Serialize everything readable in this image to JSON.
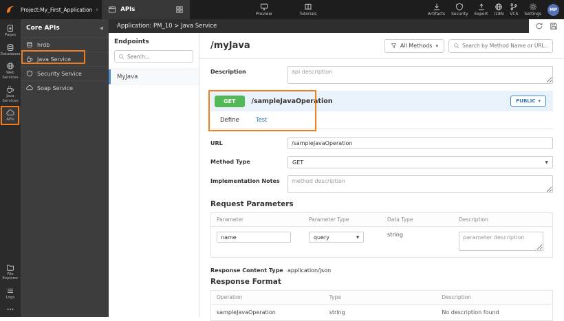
{
  "colors": {
    "accent_orange": "#ee7d1e",
    "get_green": "#53b857",
    "link_blue": "#3176ad",
    "avatar_blue": "#5572b9",
    "operation_header_bg": "#e9f2fb"
  },
  "icons": {
    "chevron": "›",
    "caret_down": "▾",
    "select_caret": "▼",
    "collapse_left": "◀"
  },
  "topbar": {
    "project_label": "Project:My_First_Application",
    "tab_label": "APIs",
    "preview_label": "Preview",
    "tutorials_label": "Tutorials",
    "tools": [
      {
        "label": "Artifacts"
      },
      {
        "label": "Security"
      },
      {
        "label": "Export"
      },
      {
        "label": "I18N"
      },
      {
        "label": "VCS"
      },
      {
        "label": "Settings"
      }
    ],
    "avatar_initials": "MP"
  },
  "nav_rail": {
    "items": [
      {
        "label": "Pages"
      },
      {
        "label": "Databases"
      },
      {
        "label": "Web Services"
      },
      {
        "label": "Java Services"
      },
      {
        "label": "APIs"
      },
      {
        "label": "File Explorer"
      },
      {
        "label": "Logs"
      }
    ]
  },
  "core_apis": {
    "title": "Core APIs",
    "items": [
      {
        "label": "hrdb"
      },
      {
        "label": "Java Service"
      },
      {
        "label": "Security Service"
      },
      {
        "label": "Soap Service"
      }
    ]
  },
  "app_header": {
    "breadcrumb": "Application: PM_10 > Java Service"
  },
  "endpoints": {
    "title": "Endpoints",
    "search_placeholder": "Search...",
    "items": [
      {
        "label": "MyJava"
      }
    ]
  },
  "main": {
    "title": "/myJava",
    "methods_filter_label": "All Methods",
    "search_placeholder": "Search by Method Name or URL...",
    "description": {
      "label": "Description",
      "value": "api description"
    },
    "operation": {
      "method": "GET",
      "path": "/sampleJavaOperation",
      "visibility_label": "PUBLIC",
      "tabs": [
        {
          "label": "Define"
        },
        {
          "label": "Test"
        }
      ]
    },
    "form": {
      "url_label": "URL",
      "url_value": "/sampleJavaOperation",
      "method_type_label": "Method Type",
      "method_type_value": "GET",
      "implementation_notes_label": "Implementation Notes",
      "implementation_notes_value": "method description"
    },
    "request_parameters": {
      "heading": "Request Parameters",
      "headers": [
        "Parameter",
        "Parameter Type",
        "Data Type",
        "Description"
      ],
      "rows": [
        {
          "parameter": "name",
          "parameter_type": "query",
          "data_type": "string",
          "description": "parameter description"
        }
      ]
    },
    "response_content_type": {
      "label": "Response Content Type",
      "value": "application/json"
    },
    "response_format": {
      "heading": "Response Format",
      "headers": [
        "Operation",
        "Type",
        "Description"
      ],
      "rows": [
        {
          "operation": "sampleJavaOperation",
          "type": "string",
          "description": "No description found"
        }
      ]
    }
  }
}
